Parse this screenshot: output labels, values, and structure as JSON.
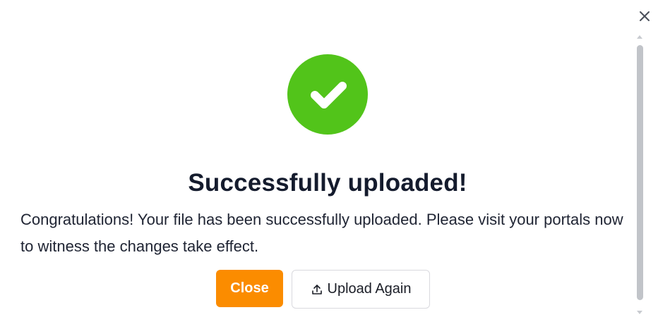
{
  "dialog": {
    "close_icon": "close-icon",
    "status_icon": "check-circle-icon",
    "status_color": "#52c41a",
    "title": "Successfully uploaded!",
    "message": "Congratulations! Your file has been successfully uploaded. Please visit your portals now to witness the changes take effect.",
    "buttons": {
      "close_label": "Close",
      "close_color": "#fb8c00",
      "upload_again_label": "Upload Again",
      "upload_again_icon": "upload-icon"
    }
  }
}
